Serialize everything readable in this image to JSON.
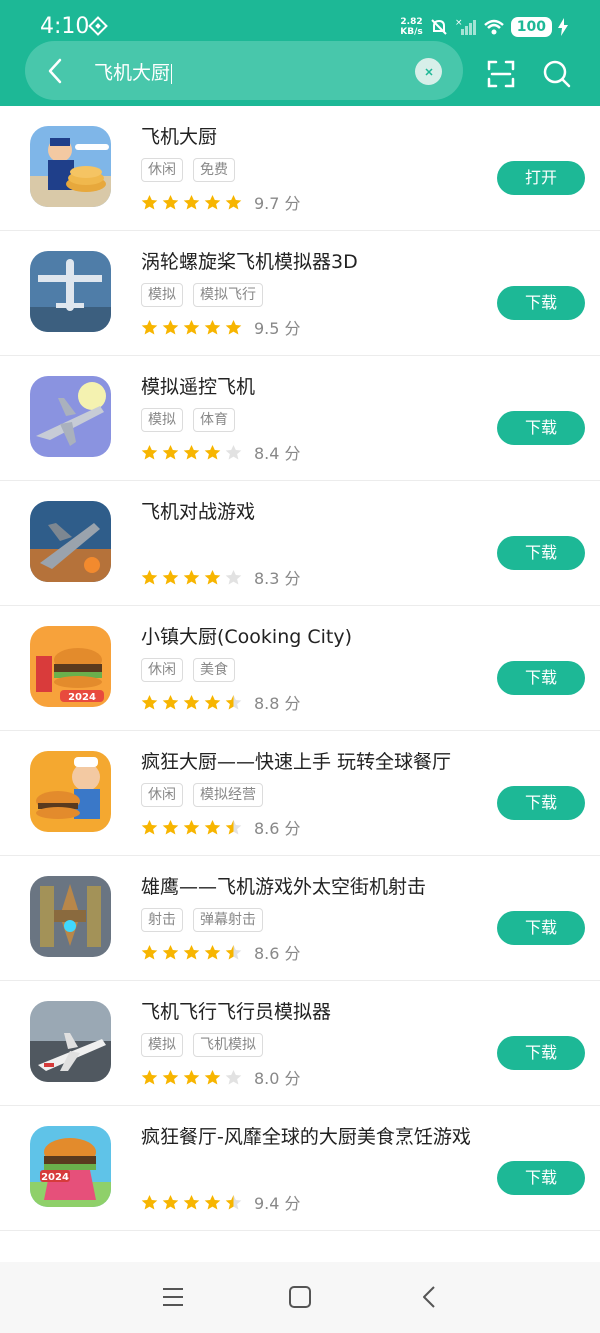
{
  "status_bar": {
    "time": "4:10",
    "net_speed_value": "2.82",
    "net_speed_unit": "KB/s",
    "battery": "100"
  },
  "search": {
    "query": "飞机大厨"
  },
  "results": [
    {
      "title": "飞机大厨",
      "tags": [
        "休闲",
        "免费"
      ],
      "rating": 9.7,
      "stars": 5,
      "score_text": "9.7 分",
      "action": "打开"
    },
    {
      "title": "涡轮螺旋桨飞机模拟器3D",
      "tags": [
        "模拟",
        "模拟飞行"
      ],
      "rating": 9.5,
      "stars": 5,
      "score_text": "9.5 分",
      "action": "下载"
    },
    {
      "title": "模拟遥控飞机",
      "tags": [
        "模拟",
        "体育"
      ],
      "rating": 8.4,
      "stars": 4,
      "score_text": "8.4 分",
      "action": "下载"
    },
    {
      "title": "飞机对战游戏",
      "tags": [],
      "rating": 8.3,
      "stars": 4,
      "score_text": "8.3 分",
      "action": "下载"
    },
    {
      "title": "小镇大厨(Cooking City)",
      "tags": [
        "休闲",
        "美食"
      ],
      "rating": 8.8,
      "stars": 4.5,
      "score_text": "8.8 分",
      "action": "下载"
    },
    {
      "title": "疯狂大厨——快速上手 玩转全球餐厅",
      "tags": [
        "休闲",
        "模拟经营"
      ],
      "rating": 8.6,
      "stars": 4.5,
      "score_text": "8.6 分",
      "action": "下载"
    },
    {
      "title": "雄鹰——飞机游戏外太空街机射击",
      "tags": [
        "射击",
        "弹幕射击"
      ],
      "rating": 8.6,
      "stars": 4.5,
      "score_text": "8.6 分",
      "action": "下载"
    },
    {
      "title": "飞机飞行飞行员模拟器",
      "tags": [
        "模拟",
        "飞机模拟"
      ],
      "rating": 8.0,
      "stars": 4,
      "score_text": "8.0 分",
      "action": "下载"
    },
    {
      "title": "疯狂餐厅-风靡全球的大厨美食烹饪游戏",
      "tags": [],
      "rating": 9.4,
      "stars": 4.5,
      "score_text": "9.4 分",
      "action": "下载"
    }
  ],
  "icons": [
    "chevron-left-icon",
    "clear-icon",
    "scan-icon",
    "search-icon",
    "star-icon",
    "menu-icon",
    "home-icon",
    "back-icon"
  ],
  "colors": {
    "accent": "#1db896",
    "star": "#f7b500",
    "star_empty": "#e2e2e2"
  }
}
